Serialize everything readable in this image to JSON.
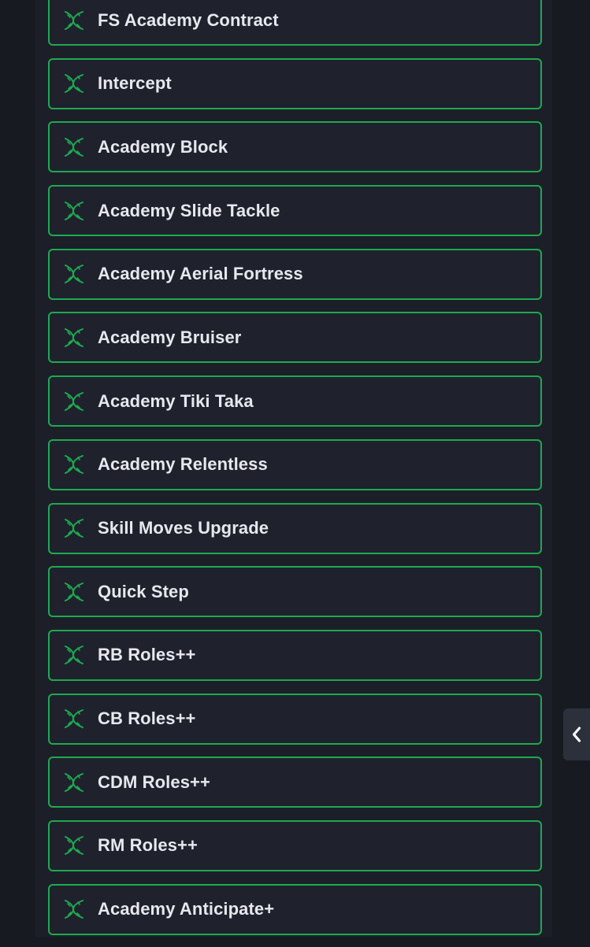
{
  "items": [
    {
      "label": "FS Academy Contract",
      "icon": "dna-icon"
    },
    {
      "label": "Intercept",
      "icon": "dna-icon"
    },
    {
      "label": "Academy Block",
      "icon": "dna-icon"
    },
    {
      "label": "Academy Slide Tackle",
      "icon": "dna-icon"
    },
    {
      "label": "Academy Aerial Fortress",
      "icon": "dna-icon"
    },
    {
      "label": "Academy Bruiser",
      "icon": "dna-icon"
    },
    {
      "label": "Academy Tiki Taka",
      "icon": "dna-icon"
    },
    {
      "label": "Academy Relentless",
      "icon": "dna-icon"
    },
    {
      "label": "Skill Moves Upgrade",
      "icon": "dna-icon"
    },
    {
      "label": "Quick Step",
      "icon": "dna-icon"
    },
    {
      "label": "RB Roles++",
      "icon": "dna-icon"
    },
    {
      "label": "CB Roles++",
      "icon": "dna-icon"
    },
    {
      "label": "CDM Roles++",
      "icon": "dna-icon"
    },
    {
      "label": "RM Roles++",
      "icon": "dna-icon"
    },
    {
      "label": "Academy Anticipate+",
      "icon": "dna-icon"
    }
  ],
  "collapse_tab": {
    "icon": "chevron-left-icon"
  },
  "colors": {
    "background": "#171a21",
    "panel": "#1c1f28",
    "item_background": "#1f222c",
    "accent_green": "#1ea950",
    "text": "#e6e8ee"
  }
}
